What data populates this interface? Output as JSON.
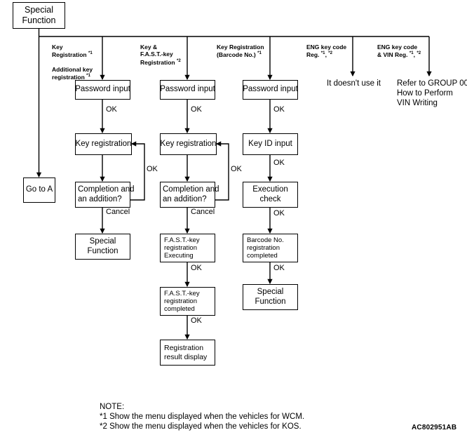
{
  "figure": {
    "code": "AC802951AB",
    "type": "flowchart",
    "orientation": "top-down"
  },
  "root": {
    "label_line1": "Special",
    "label_line2": "Function"
  },
  "branches": [
    {
      "id": "branch-key-registration",
      "label_lines": [
        "Key",
        "Registration *1",
        "",
        "Additional key",
        "registration *1"
      ],
      "label_text": "Key Registration *1 / Additional key registration *1"
    },
    {
      "id": "branch-key-fast-key-registration",
      "label_lines": [
        "Key &",
        "F.A.S.T.-key",
        "Registration *2"
      ],
      "label_text": "Key & F.A.S.T.-key Registration *2"
    },
    {
      "id": "branch-key-registration-barcode",
      "label_lines": [
        "Key Registration",
        "(Barcode No.) *1"
      ],
      "label_text": "Key Registration (Barcode No.) *1"
    },
    {
      "id": "branch-eng-key-code-reg",
      "label_lines": [
        "ENG key code",
        "Reg. *1, *2"
      ],
      "label_text": "ENG key code Reg. *1, *2"
    },
    {
      "id": "branch-eng-key-code-vin-reg",
      "label_lines": [
        "ENG key code",
        "& VIN Reg. *1, *2"
      ],
      "label_text": "ENG key code & VIN Reg. *1, *2"
    }
  ],
  "column1": {
    "goto": "Go to A",
    "password_input": "Password input",
    "key_registration": "Key registration",
    "completion_l1": "Completion and",
    "completion_l2": "an addition?",
    "special_l1": "Special",
    "special_l2": "Function",
    "edge_ok_1": "OK",
    "edge_ok_loop": "OK",
    "edge_cancel": "Cancel"
  },
  "column2": {
    "password_input": "Password input",
    "key_registration": "Key registration",
    "completion_l1": "Completion and",
    "completion_l2": "an addition?",
    "fast_exec_l1": "F.A.S.T.-key",
    "fast_exec_l2": "registration",
    "fast_exec_l3": "Executing",
    "fast_done_l1": "F.A.S.T.-key",
    "fast_done_l2": "registration",
    "fast_done_l3": "completed",
    "result_l1": "Registration",
    "result_l2": "result display",
    "edge_ok_1": "OK",
    "edge_ok_loop": "OK",
    "edge_cancel": "Cancel",
    "edge_ok_2": "OK",
    "edge_ok_3": "OK"
  },
  "column3": {
    "password_input": "Password input",
    "key_id_input": "Key ID input",
    "execution_l1": "Execution",
    "execution_l2": "check",
    "barcode_l1": "Barcode No.",
    "barcode_l2": "registration",
    "barcode_l3": "completed",
    "special_l1": "Special",
    "special_l2": "Function",
    "edge_ok_1": "OK",
    "edge_ok_2": "OK",
    "edge_ok_3": "OK",
    "edge_ok_4": "OK"
  },
  "column4": {
    "terminal_text": "It doesn't use it"
  },
  "column5": {
    "terminal_l1": "Refer to GROUP 00",
    "terminal_l2": "How to Perform",
    "terminal_l3": "VIN Writing"
  },
  "notes": {
    "heading": "NOTE:",
    "note1": "*1 Show the menu displayed when the vehicles for WCM.",
    "note2": "*2 Show the menu displayed when the vehicles for KOS."
  },
  "colors": {
    "stroke": "#000000",
    "background": "#ffffff",
    "text": "#000000"
  }
}
